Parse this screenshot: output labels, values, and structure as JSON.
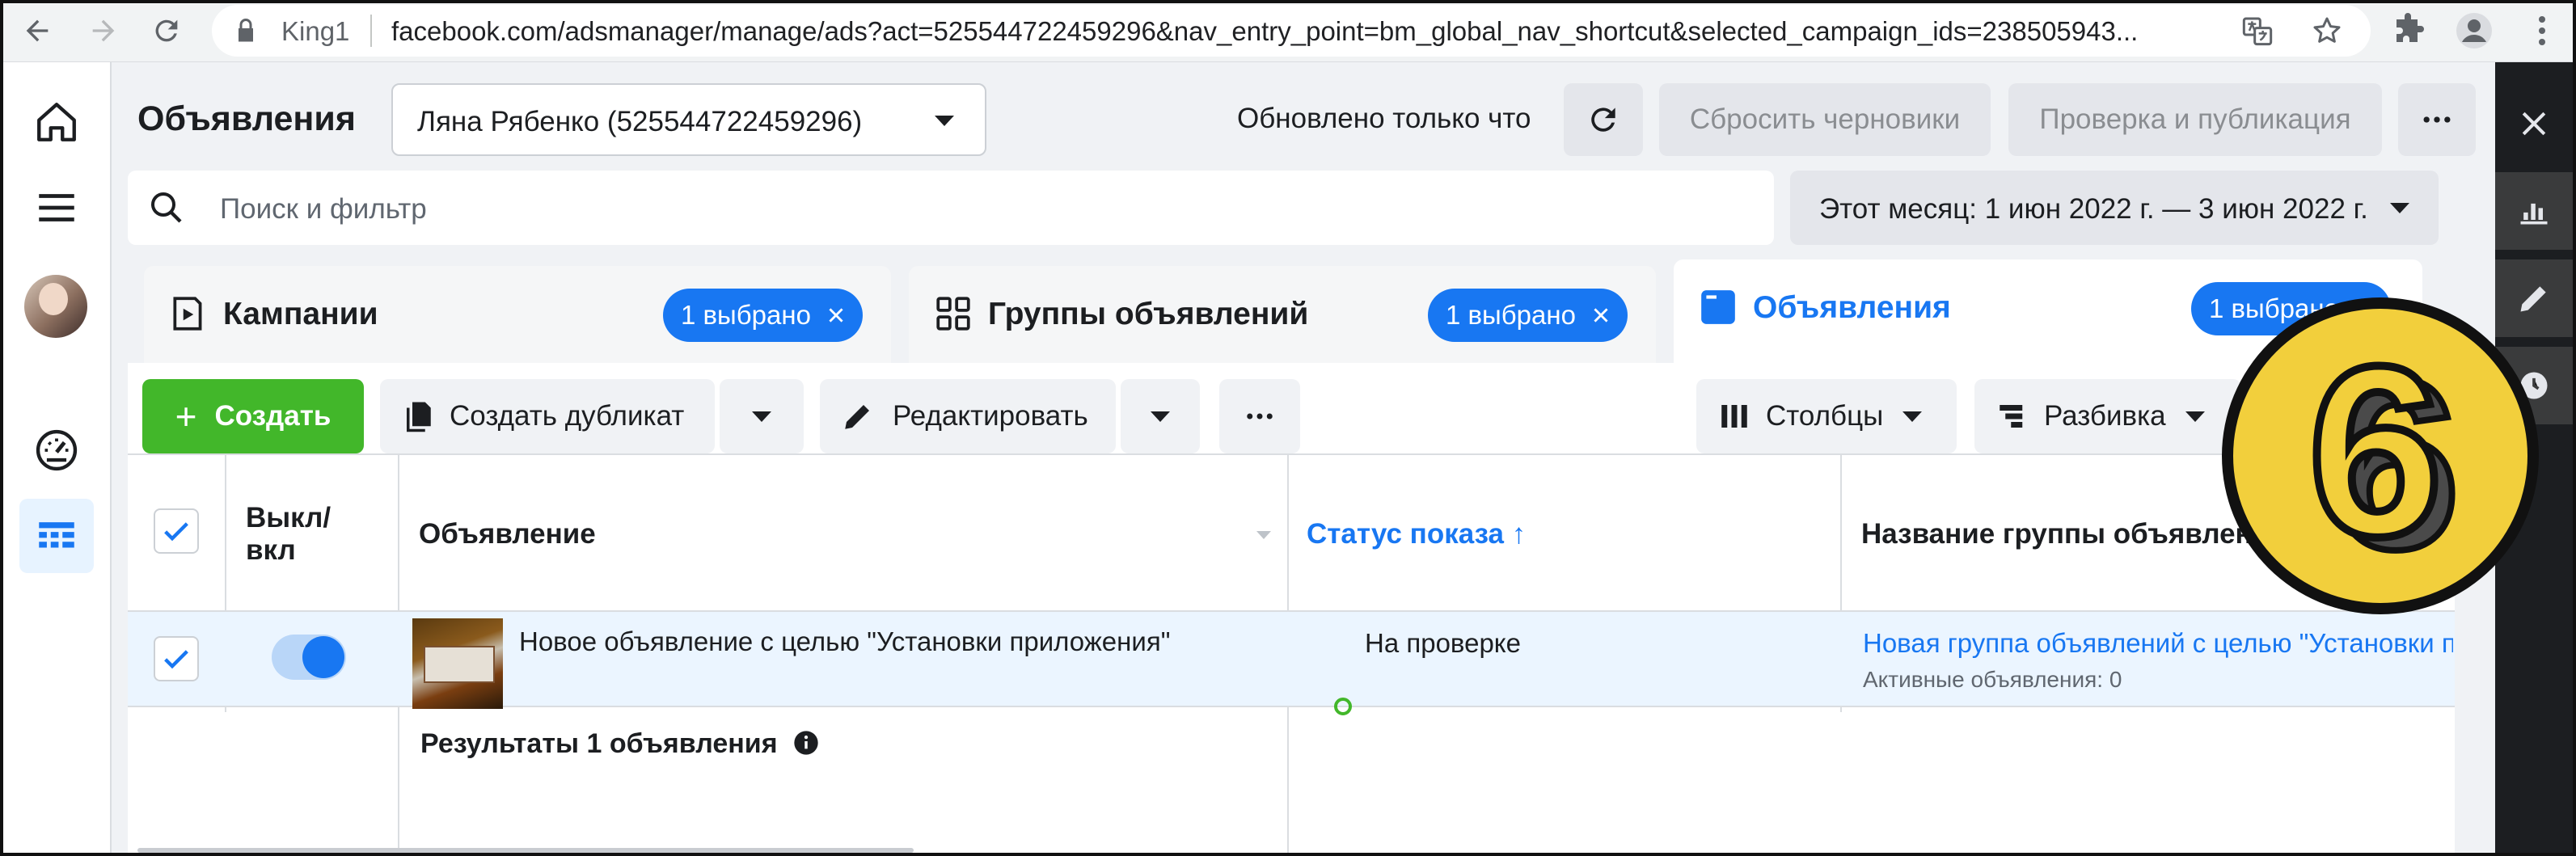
{
  "browser": {
    "site_name": "King1",
    "url": "facebook.com/adsmanager/manage/ads?act=525544722459296&nav_entry_point=bm_global_nav_shortcut&selected_campaign_ids=238505943..."
  },
  "header": {
    "title": "Объявления",
    "account": "Ляна Рябенко (525544722459296)",
    "updated": "Обновлено только что",
    "discard_drafts": "Сбросить черновики",
    "review_publish": "Проверка и публикация"
  },
  "search": {
    "placeholder": "Поиск и фильтр"
  },
  "date_range": "Этот месяц: 1 июн 2022 г. — 3 июн 2022 г.",
  "tabs": [
    {
      "label": "Кампании",
      "badge": "1 выбрано"
    },
    {
      "label": "Группы объявлений",
      "badge": "1 выбрано"
    },
    {
      "label": "Объявления",
      "badge": "1 выбрано"
    }
  ],
  "toolbar": {
    "create": "Создать",
    "duplicate": "Создать дубликат",
    "edit": "Редактировать",
    "columns": "Столбцы",
    "breakdown": "Разбивка"
  },
  "table": {
    "headers": {
      "toggle": "Выкл/ вкл",
      "ad": "Объявление",
      "delivery": "Статус показа ↑",
      "adset_name": "Название группы объявлений"
    },
    "rows": [
      {
        "ad_name": "Новое объявление с целью \"Установки приложения\"",
        "delivery": "На проверке",
        "adset_name": "Новая группа объявлений с целью \"Установки приложения\"",
        "adset_sub": "Активные объявления: 0",
        "enabled": true,
        "selected": true
      }
    ],
    "summary": "Результаты 1 объявления"
  },
  "badge": {
    "number": "6",
    "colors": {
      "fill": "#f2cf3c",
      "ring": "#111111"
    }
  },
  "colors": {
    "accent": "#1877f2",
    "create": "#42b72a",
    "status_dot": "#42b72a"
  }
}
